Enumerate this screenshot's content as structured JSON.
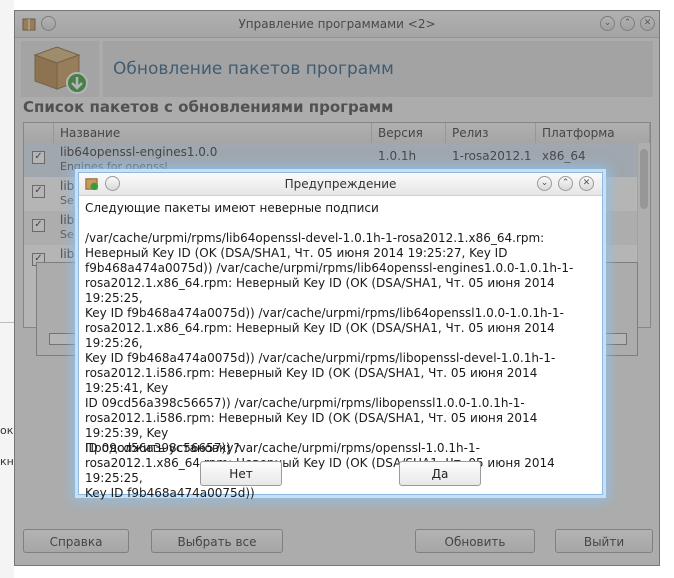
{
  "main_window": {
    "title": "Управление программами <2>",
    "header_title": "Обновление пакетов программ",
    "list_title": "Список пакетов с обновлениями программ",
    "columns": [
      "Название",
      "Версия",
      "Релиз",
      "Платформа"
    ],
    "rows": [
      {
        "name": "lib64openssl-engines1.0.0",
        "summary": "Engines for openssl",
        "version": "1.0.1h",
        "release": "1-rosa2012.1",
        "arch": "x86_64",
        "checked": true
      },
      {
        "name": "lib",
        "summary": "Se",
        "version": "",
        "release": "",
        "arch": "",
        "checked": true
      },
      {
        "name": "lib",
        "summary": "Se",
        "version": "",
        "release": "",
        "arch": "",
        "checked": true
      },
      {
        "name": "lib",
        "summary": "",
        "version": "",
        "release": "",
        "arch": "",
        "checked": true
      }
    ],
    "buttons": {
      "help": "Справка",
      "select_all": "Выбрать все",
      "update": "Обновить",
      "exit": "Выйти"
    }
  },
  "desktop_fragments": [
    "ока",
    "кн"
  ],
  "dialog": {
    "title": "Предупреждение",
    "message": "Следующие пакеты имеют неверные подписи",
    "paths": "/var/cache/urpmi/rpms/lib64openssl-devel-1.0.1h-1-rosa2012.1.x86_64.rpm:\nНеверный Key ID (OK (DSA/SHA1, Чт. 05 июня 2014 19:25:27, Key ID\nf9b468a474a0075d)) /var/cache/urpmi/rpms/lib64openssl-engines1.0.0-1.0.1h-1-\nrosa2012.1.x86_64.rpm: Неверный Key ID (OK (DSA/SHA1, Чт. 05 июня 2014 19:25:25,\nKey ID f9b468a474a0075d)) /var/cache/urpmi/rpms/lib64openssl1.0.0-1.0.1h-1-\nrosa2012.1.x86_64.rpm: Неверный Key ID (OK (DSA/SHA1, Чт. 05 июня 2014 19:25:26,\nKey ID f9b468a474a0075d)) /var/cache/urpmi/rpms/libopenssl-devel-1.0.1h-1-\nrosa2012.1.i586.rpm: Неверный Key ID (OK (DSA/SHA1, Чт. 05 июня 2014 19:25:41, Key\nID 09cd56a398c56657)) /var/cache/urpmi/rpms/libopenssl1.0.0-1.0.1h-1-\nrosa2012.1.i586.rpm: Неверный Key ID (OK (DSA/SHA1, Чт. 05 июня 2014 19:25:39, Key\nID 09cd56a398c56657)) /var/cache/urpmi/rpms/openssl-1.0.1h-1-\nrosa2012.1.x86_64.rpm: Неверный Key ID (OK (DSA/SHA1, Чт. 05 июня 2014 19:25:25,\nKey ID f9b468a474a0075d))",
    "question": "Продолжить установку?",
    "no_label": "Нет",
    "yes_label": "Да"
  },
  "progress": {
    "fraction": 0.0
  },
  "colors": {
    "accent": "#2c5d86",
    "dialog_glow": "#8fc3f0",
    "progress": "#3b8bd6"
  }
}
